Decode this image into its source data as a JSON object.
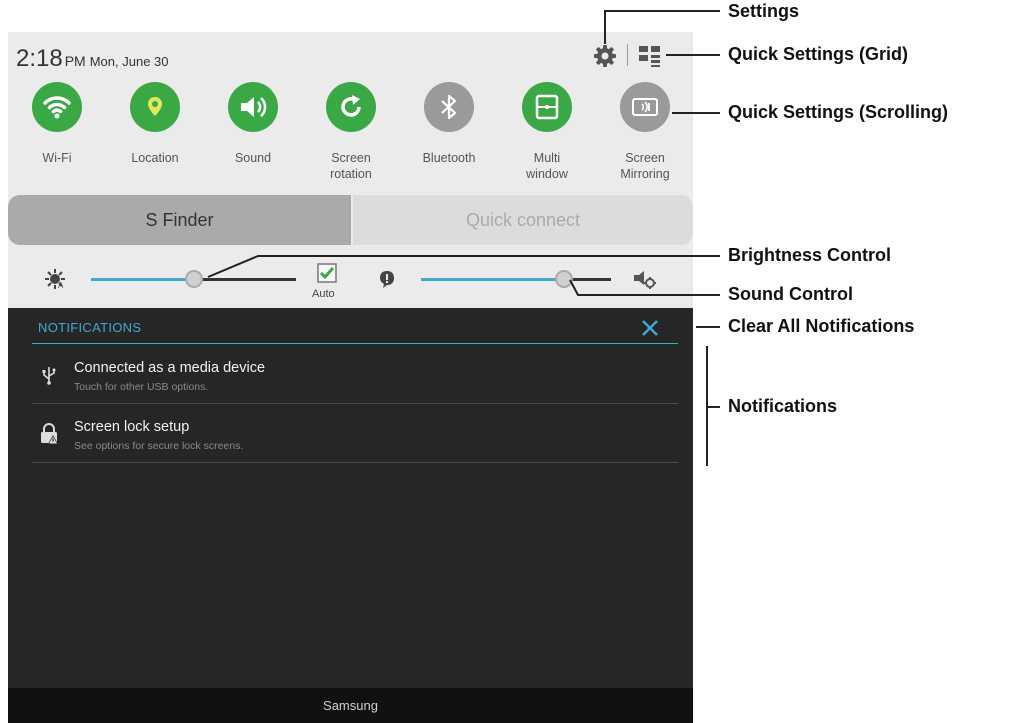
{
  "status_bar": {
    "time": "2:18",
    "ampm": "PM",
    "date": "Mon, June 30",
    "settings_icon": "gear-icon",
    "grid_icon": "grid-icon"
  },
  "quick_settings": [
    {
      "label": "Wi-Fi",
      "icon": "wifi-icon",
      "active": true
    },
    {
      "label": "Location",
      "icon": "location-icon",
      "active": true
    },
    {
      "label": "Sound",
      "icon": "sound-icon",
      "active": true
    },
    {
      "label": "Screen\nrotation",
      "icon": "rotation-icon",
      "active": true
    },
    {
      "label": "Bluetooth",
      "icon": "bluetooth-icon",
      "active": false
    },
    {
      "label": "Multi\nwindow",
      "icon": "multi-window-icon",
      "active": true
    },
    {
      "label": "Screen\nMirroring",
      "icon": "screen-mirroring-icon",
      "active": false
    }
  ],
  "buttons": {
    "s_finder": "S Finder",
    "quick_connect": "Quick connect"
  },
  "brightness": {
    "level": 0.5,
    "auto_label": "Auto",
    "auto_checked": true
  },
  "volume": {
    "level": 0.75
  },
  "notifications": {
    "title": "NOTIFICATIONS",
    "items": [
      {
        "title": "Connected as a media device",
        "subtitle": "Touch for other USB options.",
        "icon": "usb-icon"
      },
      {
        "title": "Screen lock setup",
        "subtitle": "See options for secure lock screens.",
        "icon": "lock-warning-icon"
      }
    ]
  },
  "footer": {
    "carrier": "Samsung"
  },
  "callouts": {
    "settings": "Settings",
    "quick_settings_grid": "Quick Settings (Grid)",
    "quick_settings_scrolling": "Quick Settings (Scrolling)",
    "brightness_control": "Brightness Control",
    "sound_control": "Sound Control",
    "clear_all": "Clear All Notifications",
    "notifications": "Notifications"
  },
  "colors": {
    "active_green": "#3aa845",
    "accent_blue": "#3fa9d6",
    "panel_light": "#ebebeb",
    "panel_dark": "#262626"
  }
}
